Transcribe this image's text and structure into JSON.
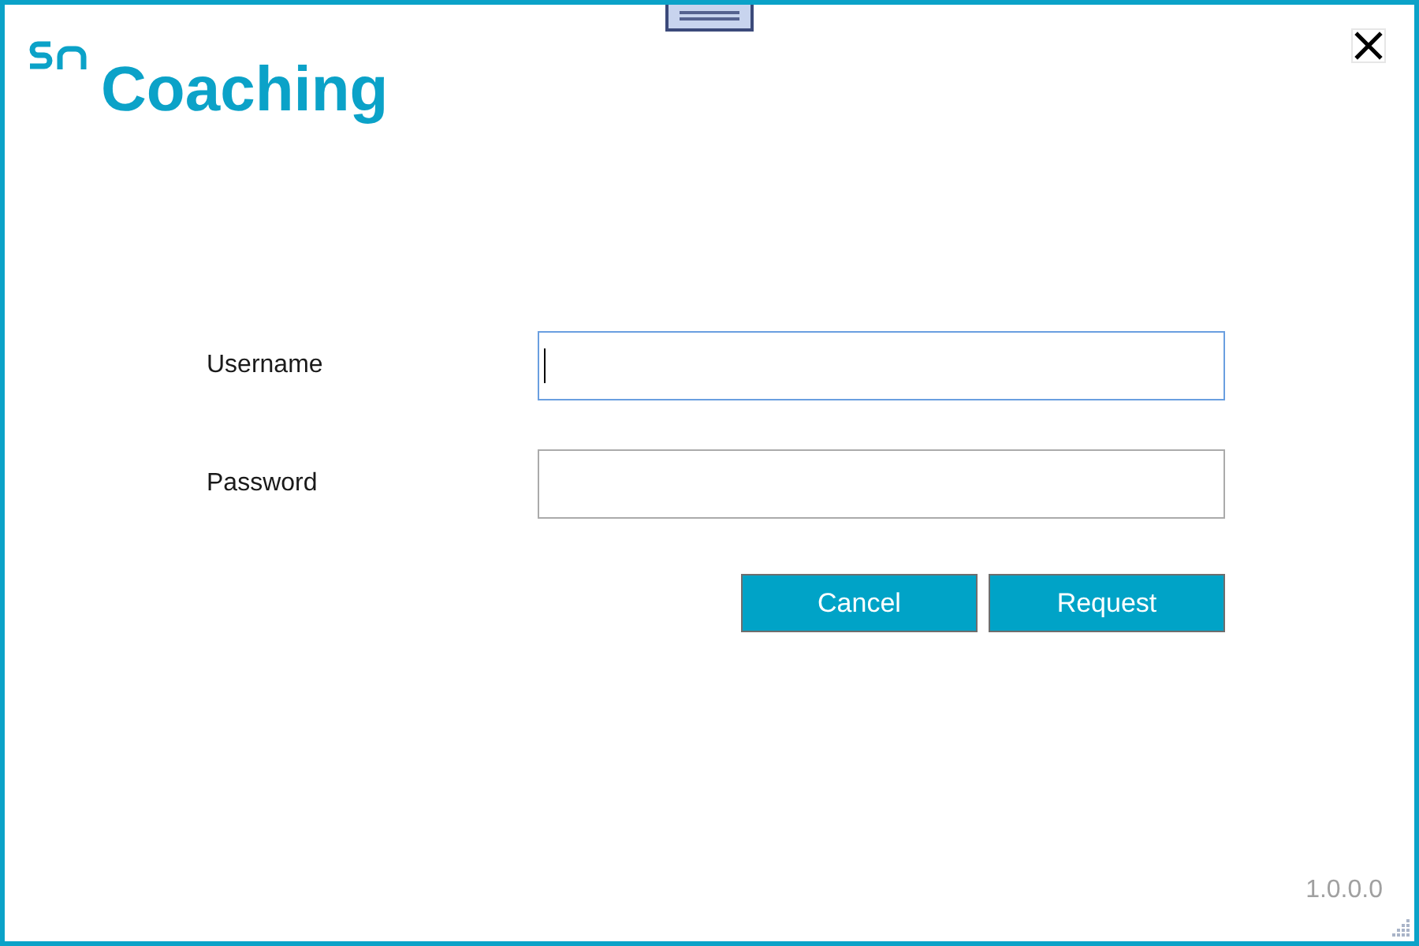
{
  "window": {
    "title": "Coaching",
    "version": "1.0.0.0"
  },
  "form": {
    "fields": [
      {
        "label": "Username",
        "focused": true
      },
      {
        "label": "Password",
        "focused": false
      }
    ]
  },
  "buttons": [
    {
      "label": "Cancel"
    },
    {
      "label": "Request"
    }
  ]
}
